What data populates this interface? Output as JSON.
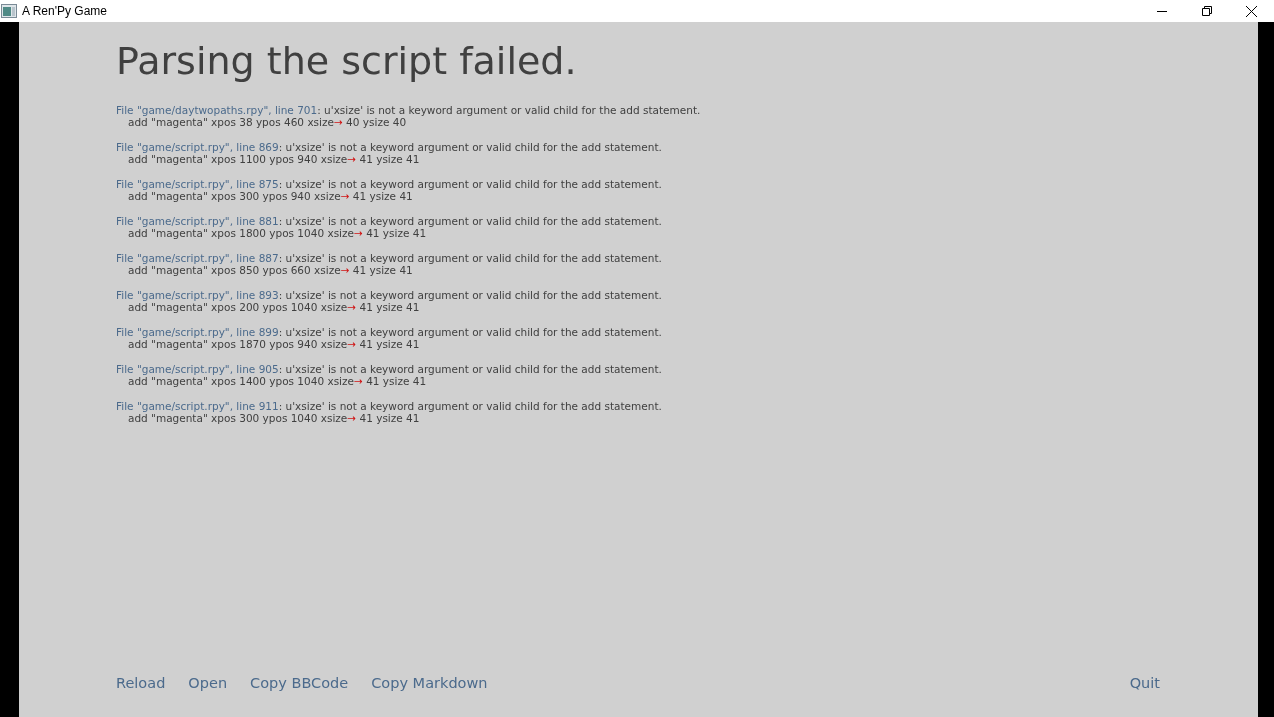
{
  "window": {
    "title": "A Ren'Py Game"
  },
  "heading": "Parsing the script failed.",
  "errors": [
    {
      "location": "File \"game/daytwopaths.rpy\", line 701",
      "message": ": u'xsize' is not a keyword argument or valid child for the add statement.",
      "code_before": "add \"magenta\" xpos 38 ypos 460 xsize",
      "marker": "→",
      "code_after": " 40 ysize 40"
    },
    {
      "location": "File \"game/script.rpy\", line 869",
      "message": ": u'xsize' is not a keyword argument or valid child for the add statement.",
      "code_before": "add \"magenta\" xpos 1100 ypos 940 xsize",
      "marker": "→",
      "code_after": " 41 ysize 41"
    },
    {
      "location": "File \"game/script.rpy\", line 875",
      "message": ": u'xsize' is not a keyword argument or valid child for the add statement.",
      "code_before": "add \"magenta\" xpos 300 ypos 940 xsize",
      "marker": "→",
      "code_after": " 41 ysize 41"
    },
    {
      "location": "File \"game/script.rpy\", line 881",
      "message": ": u'xsize' is not a keyword argument or valid child for the add statement.",
      "code_before": "add \"magenta\" xpos 1800 ypos 1040 xsize",
      "marker": "→",
      "code_after": " 41 ysize 41"
    },
    {
      "location": "File \"game/script.rpy\", line 887",
      "message": ": u'xsize' is not a keyword argument or valid child for the add statement.",
      "code_before": "add \"magenta\" xpos 850 ypos 660 xsize",
      "marker": "→",
      "code_after": " 41 ysize 41"
    },
    {
      "location": "File \"game/script.rpy\", line 893",
      "message": ": u'xsize' is not a keyword argument or valid child for the add statement.",
      "code_before": "add \"magenta\" xpos 200 ypos 1040 xsize",
      "marker": "→",
      "code_after": " 41 ysize 41"
    },
    {
      "location": "File \"game/script.rpy\", line 899",
      "message": ": u'xsize' is not a keyword argument or valid child for the add statement.",
      "code_before": "add \"magenta\" xpos 1870 ypos 940 xsize",
      "marker": "→",
      "code_after": " 41 ysize 41"
    },
    {
      "location": "File \"game/script.rpy\", line 905",
      "message": ": u'xsize' is not a keyword argument or valid child for the add statement.",
      "code_before": "add \"magenta\" xpos 1400 ypos 1040 xsize",
      "marker": "→",
      "code_after": " 41 ysize 41"
    },
    {
      "location": "File \"game/script.rpy\", line 911",
      "message": ": u'xsize' is not a keyword argument or valid child for the add statement.",
      "code_before": "add \"magenta\" xpos 300 ypos 1040 xsize",
      "marker": "→",
      "code_after": " 41 ysize 41"
    }
  ],
  "actions": [
    "Reload",
    "Open",
    "Copy BBCode",
    "Copy Markdown"
  ],
  "quit": "Quit"
}
